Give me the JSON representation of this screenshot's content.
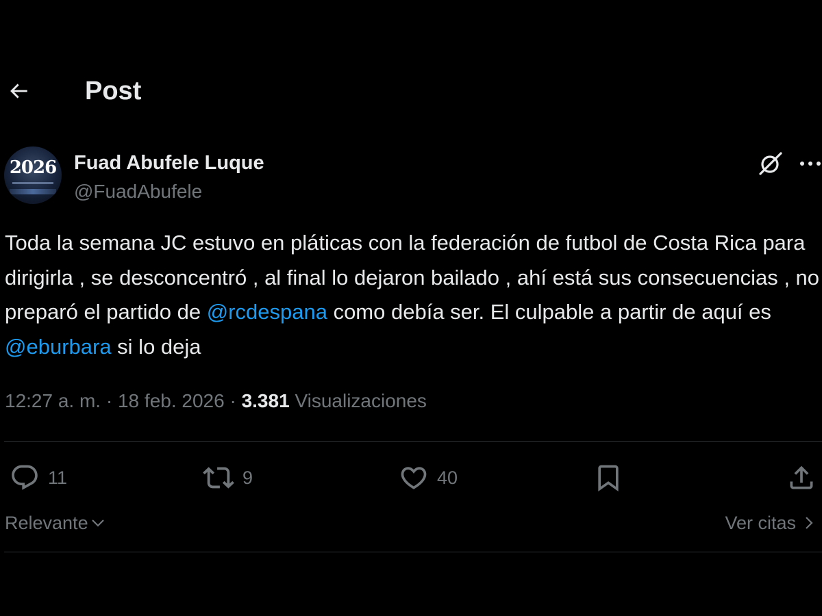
{
  "header": {
    "title": "Post"
  },
  "author": {
    "display_name": "Fuad Abufele Luque",
    "handle": "@FuadAbufele",
    "avatar_text": "2026"
  },
  "post": {
    "text_1": "Toda la semana JC estuvo en pláticas con la federación de futbol de Costa Rica para dirigirla , se desconcentró , al final lo dejaron bailado , ahí está sus consecuencias , no preparó el partido de ",
    "mention_1": "@rcdespana",
    "text_2": " como debía ser.  El culpable a partir de aquí es ",
    "mention_2": "@eburbara",
    "text_3": " si lo deja"
  },
  "meta": {
    "time": "12:27 a. m.",
    "separator": " · ",
    "date": "18 feb. 2026",
    "views_count": "3.381",
    "views_label": "Visualizaciones"
  },
  "actions": {
    "replies": "11",
    "reposts": "9",
    "likes": "40"
  },
  "footer": {
    "sort_label": "Relevante",
    "quotes_label": "Ver citas"
  },
  "icons": {
    "back": "arrow-left-icon",
    "grok": "grok-icon",
    "more": "more-horizontal-icon",
    "reply": "reply-bubble-icon",
    "repost": "repost-icon",
    "like": "heart-icon",
    "bookmark": "bookmark-icon",
    "share": "share-icon",
    "sort": "chevron-down-icon",
    "quotes": "chevron-right-icon"
  },
  "colors": {
    "background": "#000000",
    "text": "#e7e9ea",
    "secondary": "#71767b",
    "accent": "#1d9bf0",
    "divider": "#2f3336"
  }
}
